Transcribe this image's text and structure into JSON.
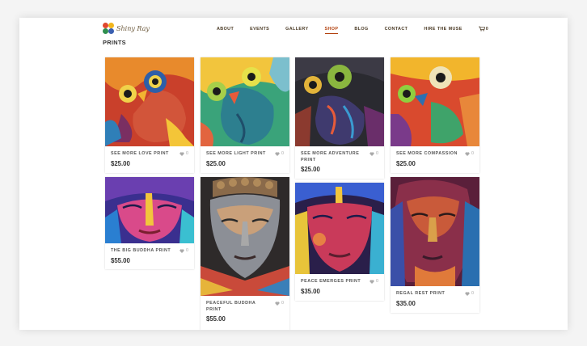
{
  "site": {
    "logo_text": "Shiny Ray"
  },
  "nav": {
    "items": [
      "ABOUT",
      "EVENTS",
      "GALLERY",
      "SHOP",
      "BLOG",
      "CONTACT",
      "HIRE THE MUSE"
    ],
    "active": "SHOP",
    "cart_count": "0"
  },
  "page": {
    "title": "PRINTS"
  },
  "products": [
    {
      "name": "SEE MORE LOVE PRINT",
      "price": "$25.00",
      "likes": "0"
    },
    {
      "name": "SEE MORE LIGHT PRINT",
      "price": "$25.00",
      "likes": "0"
    },
    {
      "name": "SEE MORE ADVENTURE PRINT",
      "price": "$25.00",
      "likes": "0"
    },
    {
      "name": "SEE MORE COMPASSION",
      "price": "$25.00",
      "likes": "0"
    },
    {
      "name": "THE BIG BUDDHA PRINT",
      "price": "$55.00",
      "likes": "0"
    },
    {
      "name": "PEACEFUL BUDDHA PRINT",
      "price": "$55.00",
      "likes": "0"
    },
    {
      "name": "PEACE EMERGES PRINT",
      "price": "$35.00",
      "likes": "0"
    },
    {
      "name": "REGAL REST PRINT",
      "price": "$35.00",
      "likes": "0"
    }
  ],
  "colors": {
    "accent": "#b2410e",
    "nav_text": "#4a3a25"
  }
}
